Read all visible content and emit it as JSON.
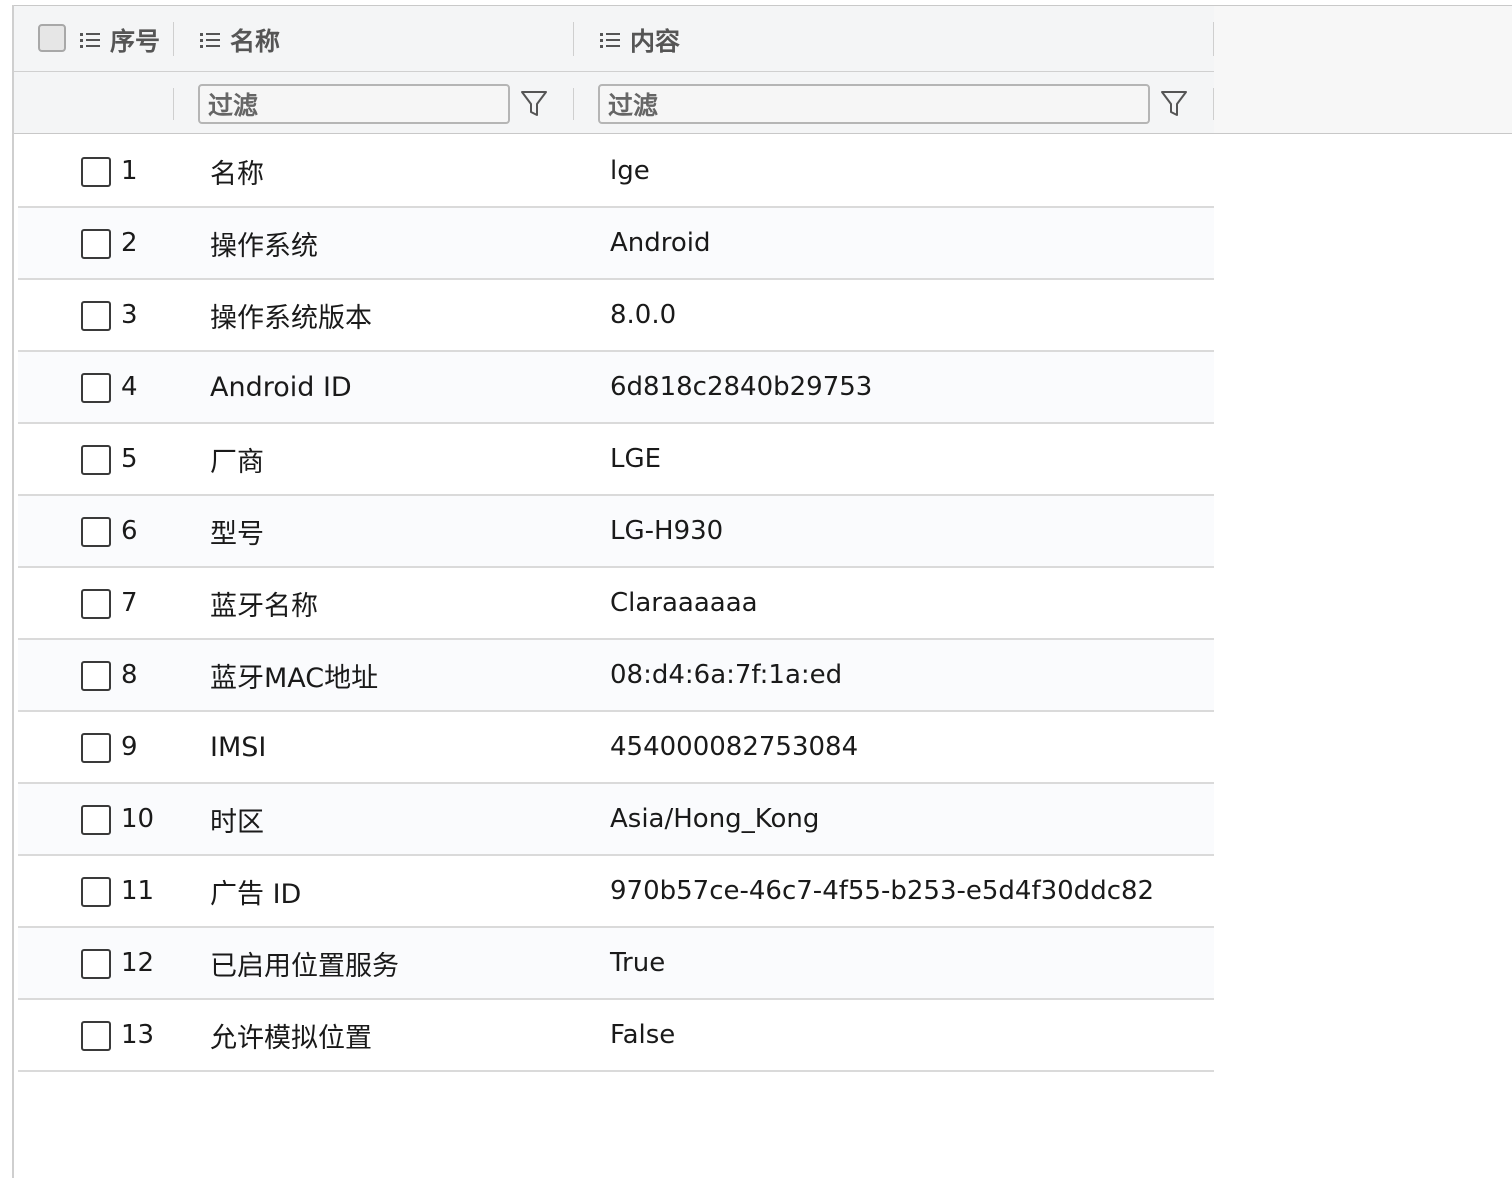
{
  "table": {
    "columns": {
      "index": "序号",
      "name": "名称",
      "content": "内容"
    },
    "filters": {
      "name_placeholder": "过滤",
      "content_placeholder": "过滤"
    },
    "rows": [
      {
        "index": "1",
        "name": "名称",
        "content": "lge",
        "checked": false
      },
      {
        "index": "2",
        "name": "操作系统",
        "content": "Android",
        "checked": false
      },
      {
        "index": "3",
        "name": "操作系统版本",
        "content": "8.0.0",
        "checked": false
      },
      {
        "index": "4",
        "name": "Android ID",
        "content": "6d818c2840b29753",
        "checked": false
      },
      {
        "index": "5",
        "name": "厂商",
        "content": "LGE",
        "checked": false
      },
      {
        "index": "6",
        "name": "型号",
        "content": "LG-H930",
        "checked": false
      },
      {
        "index": "7",
        "name": "蓝牙名称",
        "content": "Claraaaaaa",
        "checked": false
      },
      {
        "index": "8",
        "name": "蓝牙MAC地址",
        "content": "08:d4:6a:7f:1a:ed",
        "checked": false
      },
      {
        "index": "9",
        "name": "IMSI",
        "content": "454000082753084",
        "checked": false
      },
      {
        "index": "10",
        "name": "时区",
        "content": "Asia/Hong_Kong",
        "checked": false
      },
      {
        "index": "11",
        "name": "广告 ID",
        "content": "970b57ce-46c7-4f55-b253-e5d4f30ddc82",
        "checked": false
      },
      {
        "index": "12",
        "name": "已启用位置服务",
        "content": "True",
        "checked": false
      },
      {
        "index": "13",
        "name": "允许模拟位置",
        "content": "False",
        "checked": false
      }
    ]
  }
}
